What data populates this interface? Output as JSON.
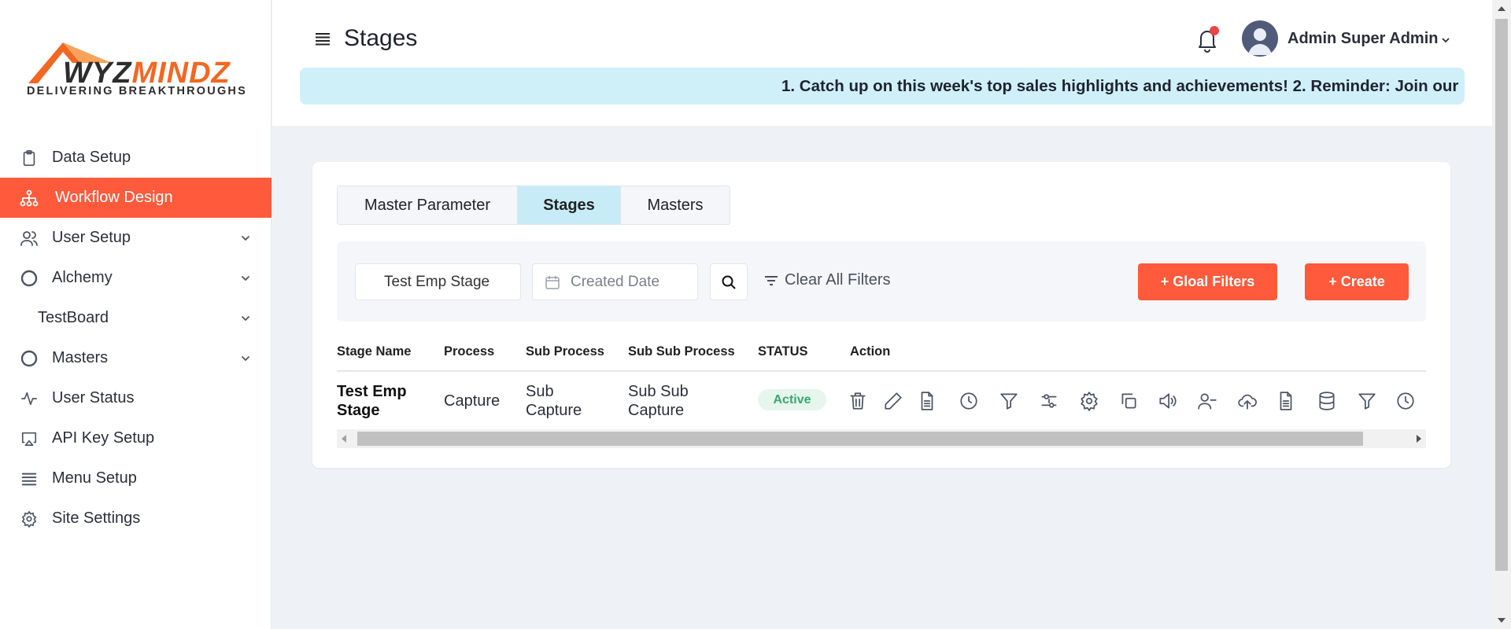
{
  "brand": {
    "name_part1": "WYZ",
    "name_part2": "MINDZ",
    "tagline": "DELIVERING  BREAKTHROUGHS"
  },
  "sidebar": {
    "items": [
      {
        "label": "Data Setup",
        "icon": "clipboard-icon",
        "has_chevron": false
      },
      {
        "label": "Workflow Design",
        "icon": "workflow-icon",
        "active": true,
        "has_chevron": false
      },
      {
        "label": "User Setup",
        "icon": "users-icon",
        "has_chevron": true
      },
      {
        "label": "Alchemy",
        "icon": "circle-icon",
        "has_chevron": true
      },
      {
        "label": "TestBoard",
        "icon": "",
        "has_chevron": true
      },
      {
        "label": "Masters",
        "icon": "circle-icon",
        "has_chevron": true
      },
      {
        "label": "User Status",
        "icon": "activity-icon",
        "has_chevron": false
      },
      {
        "label": "API Key Setup",
        "icon": "airplay-icon",
        "has_chevron": false
      },
      {
        "label": "Menu Setup",
        "icon": "list-icon",
        "has_chevron": false
      },
      {
        "label": "Site Settings",
        "icon": "gear-icon",
        "has_chevron": false
      }
    ]
  },
  "header": {
    "title": "Stages",
    "user_name": "Admin Super Admin",
    "announcement": "1. Catch up on this week's top sales highlights and achievements! 2. Reminder: Join our"
  },
  "tabs": [
    {
      "label": "Master Parameter"
    },
    {
      "label": "Stages",
      "active": true
    },
    {
      "label": "Masters"
    }
  ],
  "filters": {
    "name_value": "Test Emp Stage",
    "date_placeholder": "Created Date",
    "clear_label": "Clear All Filters",
    "global_filters_label": "+ Gloal Filters",
    "create_label": "+ Create"
  },
  "table": {
    "headers": [
      "Stage Name",
      "Process",
      "Sub Process",
      "Sub Sub Process",
      "STATUS",
      "Action"
    ],
    "rows": [
      {
        "stage_name_l1": "Test Emp",
        "stage_name_l2": "Stage",
        "process": "Capture",
        "sub_process_l1": "Sub",
        "sub_process_l2": "Capture",
        "sub_sub_process_l1": "Sub Sub",
        "sub_sub_process_l2": "Capture",
        "status": "Active"
      }
    ],
    "action_icons": [
      "trash-icon",
      "edit-icon",
      "file-icon",
      "clock-icon",
      "filter-icon",
      "sliders-icon",
      "gear-icon",
      "copy-icon",
      "speaker-icon",
      "user-minus-icon",
      "upload-cloud-icon",
      "file-icon",
      "database-icon",
      "filter-icon",
      "clock-icon"
    ]
  },
  "colors": {
    "accent": "#ff5a3c",
    "active_tab": "#c7ecf7",
    "banner": "#cff0f8",
    "status_active": "#3aa76d"
  }
}
